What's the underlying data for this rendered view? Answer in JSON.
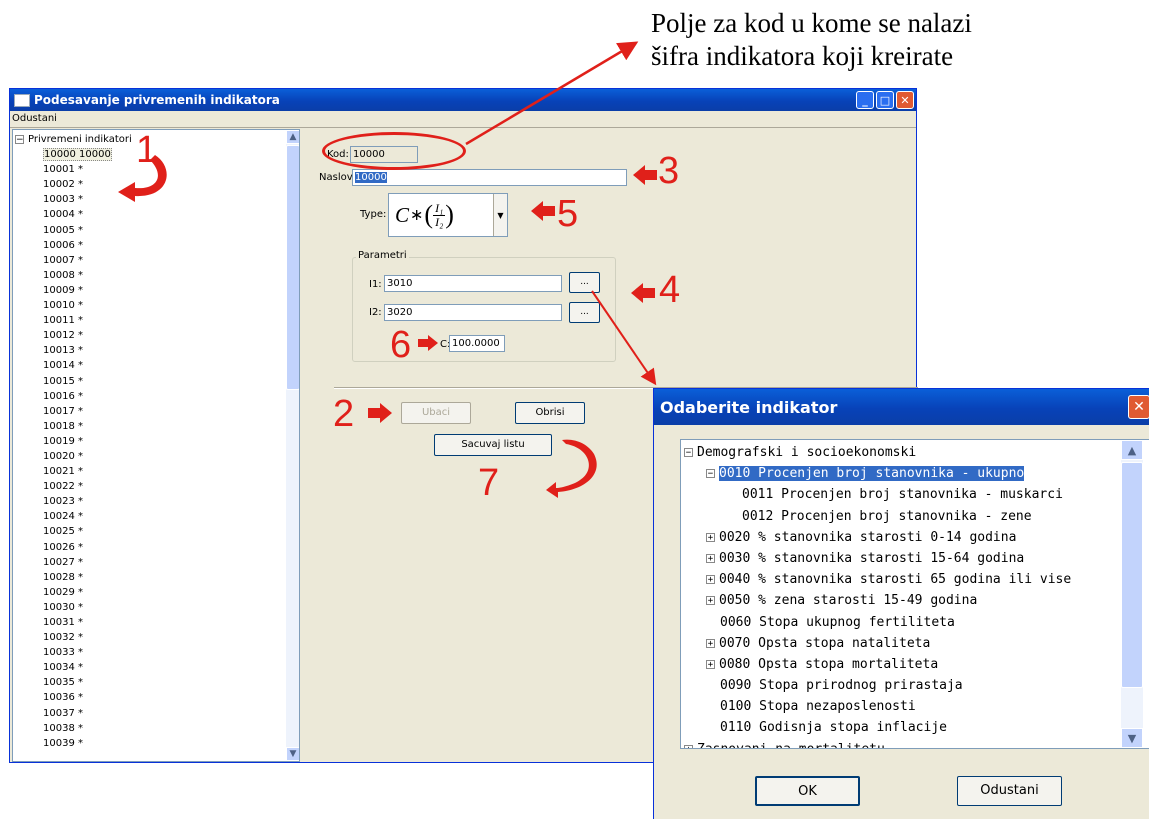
{
  "annotation_text": [
    "Polje za kod u kome se nalazi",
    "šifra indikatora koji kreirate"
  ],
  "main_window": {
    "title": "Podesavanje privremenih indikatora",
    "menu": "Odustani",
    "tree_root": "Privremeni indikatori",
    "tree_items": [
      "10000 10000",
      "10001 *",
      "10002 *",
      "10003 *",
      "10004 *",
      "10005 *",
      "10006 *",
      "10007 *",
      "10008 *",
      "10009 *",
      "10010 *",
      "10011 *",
      "10012 *",
      "10013 *",
      "10014 *",
      "10015 *",
      "10016 *",
      "10017 *",
      "10018 *",
      "10019 *",
      "10020 *",
      "10021 *",
      "10022 *",
      "10023 *",
      "10024 *",
      "10025 *",
      "10026 *",
      "10027 *",
      "10028 *",
      "10029 *",
      "10030 *",
      "10031 *",
      "10032 *",
      "10033 *",
      "10034 *",
      "10035 *",
      "10036 *",
      "10037 *",
      "10038 *",
      "10039 *"
    ],
    "kod_label": "Kod:",
    "kod_value": "10000",
    "naslov_label": "Naslov:",
    "naslov_value": "10000",
    "type_label": "Type:",
    "formula": {
      "c": "C",
      "star": "∗",
      "num": "I₁",
      "den": "I₂"
    },
    "parametri_label": "Parametri",
    "i1_label": "I1:",
    "i1_value": "3010",
    "i2_label": "I2:",
    "i2_value": "3020",
    "browse_label": "...",
    "c_label": "C:",
    "c_value": "100.0000",
    "ubaci_label": "Ubaci",
    "obrisi_label": "Obrisi",
    "sacuvaj_label": "Sacuvaj listu"
  },
  "callouts": [
    "1",
    "2",
    "3",
    "4",
    "5",
    "6",
    "7"
  ],
  "dialog": {
    "title": "Odaberite indikator",
    "items": [
      {
        "text": "Demografski i socioekonomski",
        "pm": "−"
      },
      {
        "text": "0010 Procenjen broj stanovnika - ukupno",
        "pm": "−"
      },
      {
        "text": "0011 Procenjen broj stanovnika - muskarci",
        "pm": ""
      },
      {
        "text": "0012 Procenjen broj stanovnika - zene",
        "pm": ""
      },
      {
        "text": "0020 % stanovnika starosti 0-14 godina",
        "pm": "+"
      },
      {
        "text": "0030 % stanovnika starosti 15-64 godina",
        "pm": "+"
      },
      {
        "text": "0040 % stanovnika starosti 65 godina ili vise",
        "pm": "+"
      },
      {
        "text": "0050 % zena starosti 15-49 godina",
        "pm": "+"
      },
      {
        "text": "0060 Stopa ukupnog fertiliteta",
        "pm": ""
      },
      {
        "text": "0070 Opsta stopa nataliteta",
        "pm": "+"
      },
      {
        "text": "0080 Opsta stopa mortaliteta",
        "pm": "+"
      },
      {
        "text": "0090 Stopa prirodnog prirastaja",
        "pm": ""
      },
      {
        "text": "0100 Stopa nezaposlenosti",
        "pm": ""
      },
      {
        "text": "0110 Godisnja stopa inflacije",
        "pm": ""
      },
      {
        "text": "Zasnovani na mortalitetu",
        "pm": "+"
      }
    ],
    "ok_label": "OK",
    "cancel_label": "Odustani"
  },
  "colors": {
    "accent_red": "#e0201a",
    "titlebar": "#0842b8",
    "selection": "#316ac5"
  }
}
